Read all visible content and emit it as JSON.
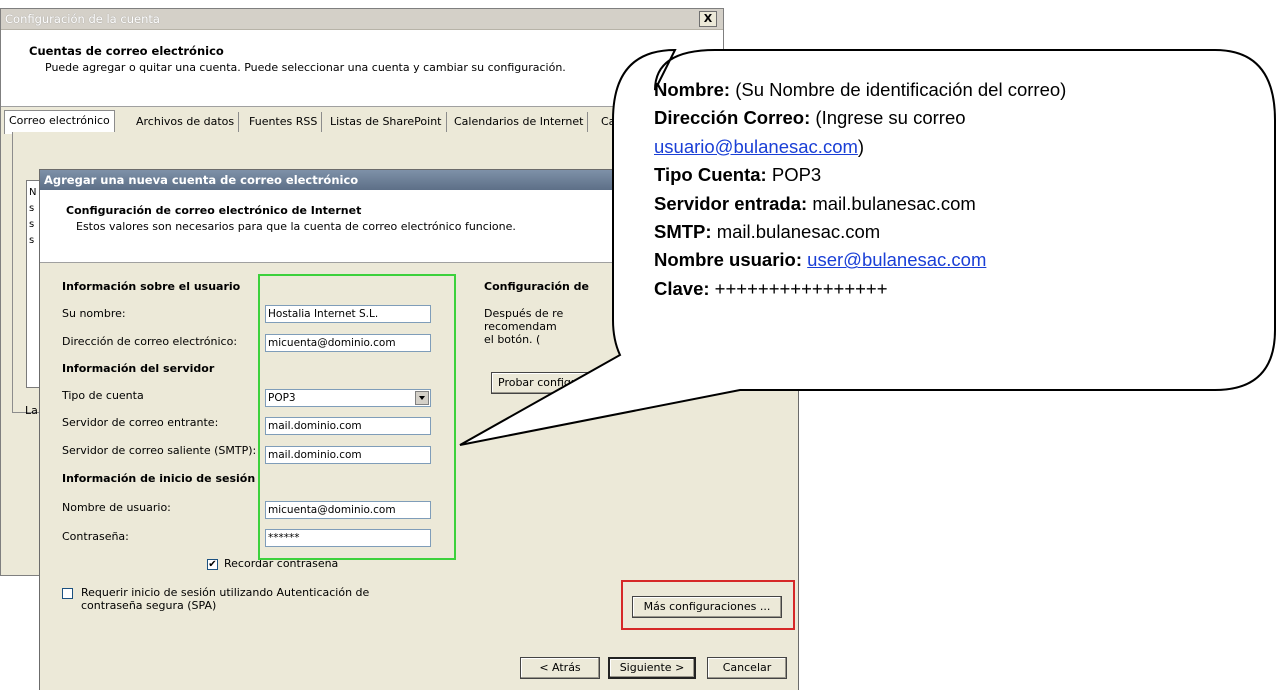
{
  "back_window": {
    "title": "Configuración de la cuenta",
    "close_label": "X",
    "header_title": "Cuentas de correo electrónico",
    "header_subtitle": "Puede agregar o quitar una cuenta. Puede seleccionar una cuenta y cambiar su configuración.",
    "tabs": [
      "Correo electrónico",
      "Archivos de datos",
      "Fuentes RSS",
      "Listas de SharePoint",
      "Calendarios de Internet",
      "Ca"
    ],
    "list_stub": [
      "N",
      "s",
      "s",
      "s"
    ],
    "bottom_stub": "La"
  },
  "dialog": {
    "title": "Agregar una nueva cuenta de correo electrónico",
    "header_title": "Configuración de correo electrónico de Internet",
    "header_subtitle": "Estos valores son necesarios para que la cuenta de correo electrónico funcione.",
    "user_info": {
      "heading": "Información sobre el usuario",
      "name_label": "Su nombre:",
      "name_value": "Hostalia Internet S.L.",
      "email_label": "Dirección de correo electrónico:",
      "email_value": "micuenta@dominio.com"
    },
    "server_info": {
      "heading": "Información del servidor",
      "type_label": "Tipo de cuenta",
      "type_value": "POP3",
      "incoming_label": "Servidor de correo entrante:",
      "incoming_value": "mail.dominio.com",
      "outgoing_label": "Servidor de correo saliente (SMTP):",
      "outgoing_value": "mail.dominio.com"
    },
    "login_info": {
      "heading": "Información de inicio de sesión",
      "user_label": "Nombre de usuario:",
      "user_value": "micuenta@dominio.com",
      "password_label": "Contraseña:",
      "password_value": "******",
      "remember_label": "Recordar contraseña",
      "remember_checked": true
    },
    "spa_label_line1": "Requerir inicio de sesión utilizando Autenticación de",
    "spa_label_line2": "contraseña segura (SPA)",
    "spa_checked": false,
    "right_section": {
      "heading": "Configuración de",
      "text_line1": "Después de re",
      "text_line2": "recomendam",
      "text_line3": "el botón. (",
      "test_button": "Probar configuración de la cuenta ..."
    },
    "more_settings_button": "Más configuraciones ...",
    "back_button": "< Atrás",
    "next_button": "Siguiente >",
    "cancel_button": "Cancelar"
  },
  "callout": {
    "name_label": "Nombre:",
    "name_text": "(Su Nombre de identificación del correo)",
    "email_label": "Dirección Correo:",
    "email_text": "(Ingrese su correo",
    "email_link": "usuario@bulanesac.com",
    "email_close": ")",
    "type_label": "Tipo Cuenta:",
    "type_value": "POP3",
    "incoming_label": "Servidor entrada:",
    "incoming_value": "mail.bulanesac.com",
    "smtp_label": "SMTP:",
    "smtp_value": "mail.bulanesac.com",
    "user_label": "Nombre usuario:",
    "user_link": "user@bulanesac.com",
    "password_label": "Clave:",
    "password_value": "++++++++++++++++"
  },
  "colors": {
    "highlight_green": "#3cd13c",
    "highlight_red": "#d62828",
    "link_blue": "#1a3fd6",
    "dialog_title_bg": "#5d6f87"
  }
}
